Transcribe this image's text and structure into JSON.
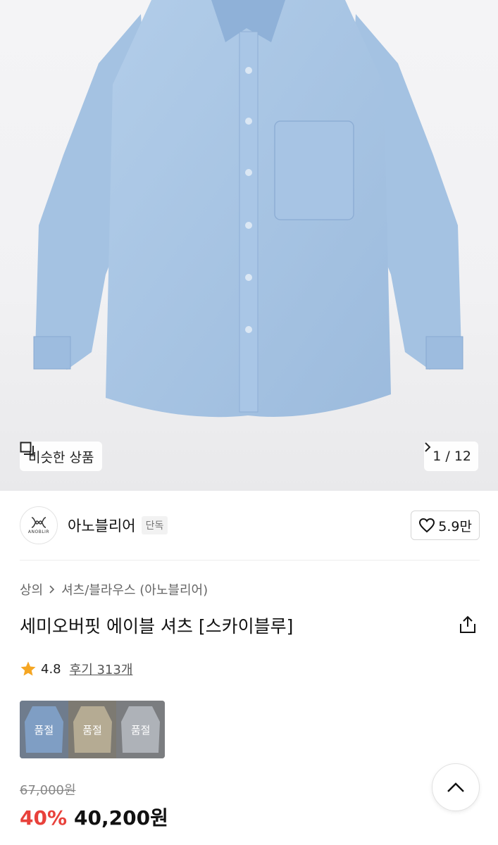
{
  "hero": {
    "similar_label": "비슷한 상품",
    "counter": "1 / 12"
  },
  "brand": {
    "logo_text": "ANOBLIR",
    "name": "아노블리어",
    "badge": "단독",
    "likes": "5.9만"
  },
  "breadcrumb": {
    "level1": "상의",
    "level2": "셔츠/블라우스 (아노블리어)"
  },
  "product": {
    "title": "세미오버핏 에이블 셔츠 [스카이블루]",
    "rating": "4.8",
    "reviews": "후기 313개"
  },
  "options": [
    {
      "label": "품절",
      "color": "#7f9ec4"
    },
    {
      "label": "품절",
      "color": "#b5ab93"
    },
    {
      "label": "품절",
      "color": "#aeb2b8"
    }
  ],
  "price": {
    "original": "67,000원",
    "discount": "40%",
    "sale": "40,200원"
  },
  "colors": {
    "discount": "#e8413b",
    "star": "#f5a623",
    "shirt": "#a7c4e3"
  }
}
